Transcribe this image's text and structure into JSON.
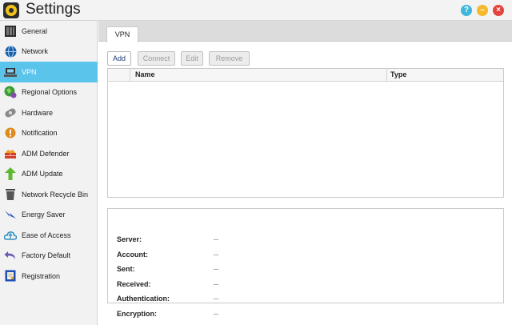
{
  "window": {
    "title": "Settings",
    "help_glyph": "?",
    "min_glyph": "–",
    "close_glyph": "×"
  },
  "sidebar": {
    "items": [
      {
        "label": "General",
        "icon": "general-icon"
      },
      {
        "label": "Network",
        "icon": "network-globe-icon"
      },
      {
        "label": "VPN",
        "icon": "vpn-icon"
      },
      {
        "label": "Regional Options",
        "icon": "regional-options-icon"
      },
      {
        "label": "Hardware",
        "icon": "hardware-icon"
      },
      {
        "label": "Notification",
        "icon": "notification-icon"
      },
      {
        "label": "ADM Defender",
        "icon": "defender-wall-icon"
      },
      {
        "label": "ADM Update",
        "icon": "update-arrow-icon"
      },
      {
        "label": "Network Recycle Bin",
        "icon": "recycle-bin-icon"
      },
      {
        "label": "Energy Saver",
        "icon": "energy-saver-icon"
      },
      {
        "label": "Ease of Access",
        "icon": "cloud-access-icon"
      },
      {
        "label": "Factory Default",
        "icon": "factory-default-icon"
      },
      {
        "label": "Registration",
        "icon": "registration-icon"
      }
    ],
    "active_index": 2
  },
  "tabs": [
    {
      "label": "VPN"
    }
  ],
  "toolbar": {
    "add_label": "Add",
    "connect_label": "Connect",
    "edit_label": "Edit",
    "remove_label": "Remove"
  },
  "table": {
    "columns": [
      "Name",
      "Type"
    ],
    "rows": []
  },
  "info": {
    "server": {
      "label": "Server:",
      "value": "--"
    },
    "account": {
      "label": "Account:",
      "value": "--"
    },
    "sent": {
      "label": "Sent:",
      "value": "--"
    },
    "received": {
      "label": "Received:",
      "value": "--"
    },
    "authentication": {
      "label": "Authentication:",
      "value": "--"
    },
    "encryption": {
      "label": "Encryption:",
      "value": "--"
    }
  },
  "colors": {
    "active_nav": "#5bc4ea",
    "help": "#3fb5d9",
    "minimize": "#f4b92c",
    "close": "#e4423c"
  }
}
